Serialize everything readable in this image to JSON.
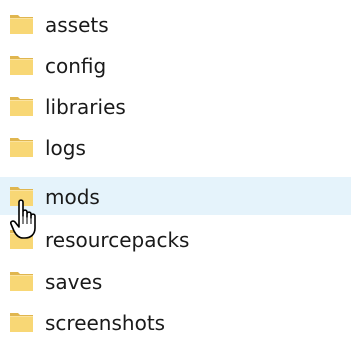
{
  "folders": [
    {
      "name": "assets",
      "icon": "folder-icon"
    },
    {
      "name": "config",
      "icon": "folder-icon"
    },
    {
      "name": "libraries",
      "icon": "folder-icon"
    },
    {
      "name": "logs",
      "icon": "folder-icon"
    },
    {
      "name": "mods",
      "icon": "folder-icon",
      "hovered": true
    },
    {
      "name": "resourcepacks",
      "icon": "folder-icon"
    },
    {
      "name": "saves",
      "icon": "folder-icon"
    },
    {
      "name": "screenshots",
      "icon": "folder-icon"
    }
  ],
  "colors": {
    "hover_background": "#e5f3fb",
    "folder_yellow": "#f8d775",
    "folder_dark": "#e0b64f",
    "text": "#1a1a1a"
  },
  "cursor": {
    "icon": "hand-pointer-icon"
  }
}
